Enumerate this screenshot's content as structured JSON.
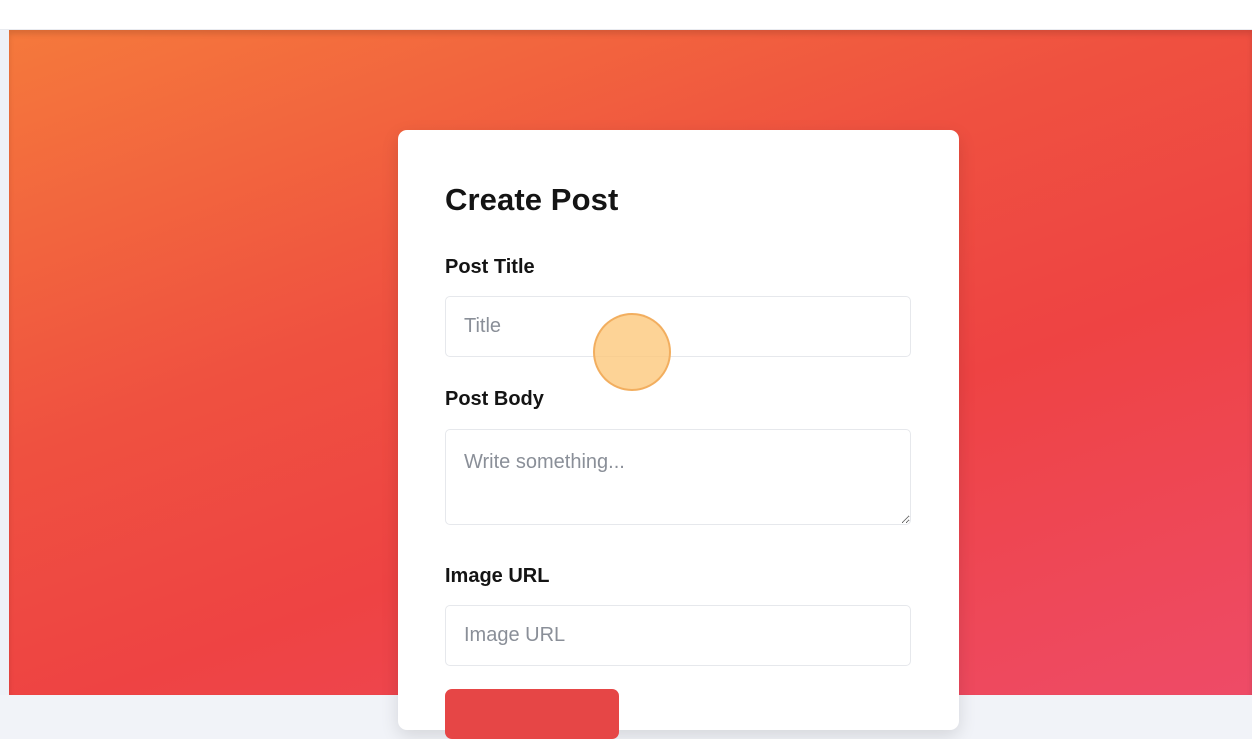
{
  "form": {
    "title": "Create Post",
    "post_title_label": "Post Title",
    "post_title_placeholder": "Title",
    "post_title_value": "",
    "post_body_label": "Post Body",
    "post_body_placeholder": "Write something...",
    "post_body_value": "",
    "image_url_label": "Image URL",
    "image_url_placeholder": "Image URL",
    "image_url_value": ""
  },
  "colors": {
    "gradient_start": "#f5793c",
    "gradient_end": "#ee4b67",
    "button": "#e64646",
    "card": "#ffffff"
  }
}
